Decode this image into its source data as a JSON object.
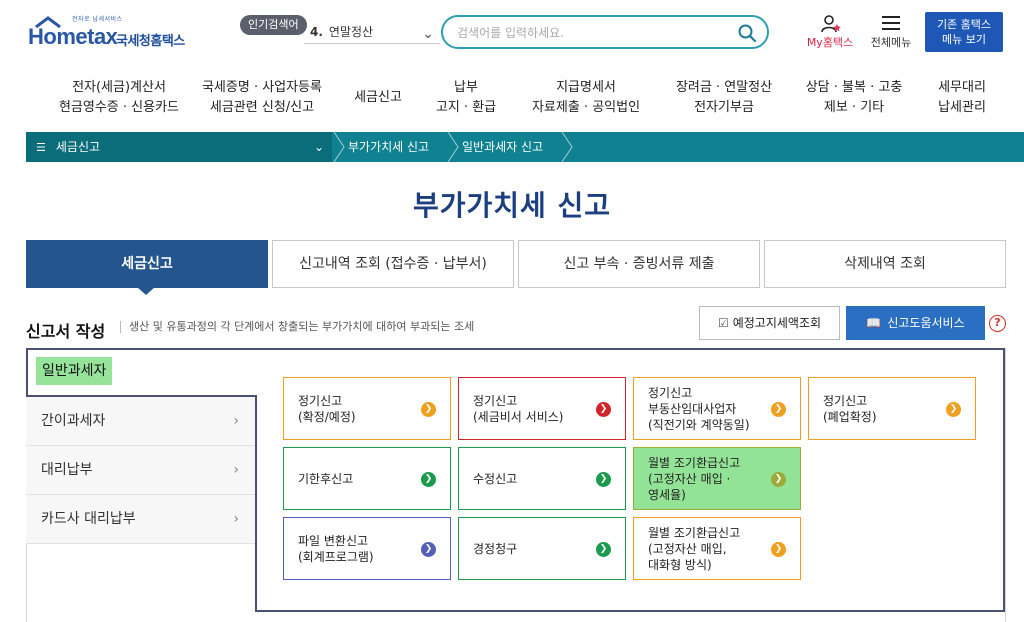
{
  "header": {
    "logo_tag": "전자로 납세서비스",
    "logo_main": "Hometax",
    "logo_kr": "국세청홈택스",
    "popular_badge": "인기검색어",
    "popular_rank": "4.",
    "popular_term": "연말정산",
    "search_placeholder": "검색어를 입력하세요.",
    "my_hometax": "My홈택스",
    "all_menu": "전체메뉴",
    "legacy_line1": "기존 홈택스",
    "legacy_line2": "메뉴 보기"
  },
  "gnb": [
    {
      "line1": "전자(세금)계산서",
      "line2": "현금영수증 · 신용카드"
    },
    {
      "line1": "국세증명 · 사업자등록",
      "line2": "세금관련 신청/신고"
    },
    {
      "line1": "세금신고",
      "line2": ""
    },
    {
      "line1": "납부",
      "line2": "고지 · 환급"
    },
    {
      "line1": "지급명세서",
      "line2": "자료제출 · 공익법인"
    },
    {
      "line1": "장려금 · 연말정산",
      "line2": "전자기부금"
    },
    {
      "line1": "상담 · 불복 · 고충",
      "line2": "제보 · 기타"
    },
    {
      "line1": "세무대리",
      "line2": "납세관리"
    }
  ],
  "breadcrumb": {
    "menu": "세금신고",
    "level1": "부가가치세 신고",
    "level2": "일반과세자 신고"
  },
  "page_title": "부가가치세 신고",
  "tabs": [
    {
      "label": "세금신고"
    },
    {
      "label": "신고내역 조회 (접수증 · 납부서)"
    },
    {
      "label": "신고 부속 · 증빙서류 제출"
    },
    {
      "label": "삭제내역 조회"
    }
  ],
  "section": {
    "title": "신고서 작성",
    "desc": "생산 및 유통과정의 각 단계에서 창출되는 부가가치에 대하여 부과되는 조세",
    "prenotice_btn": "예정고지세액조회",
    "help_btn": "신고도움서비스",
    "help_q": "?"
  },
  "side": {
    "active": "일반과세자",
    "items": [
      {
        "label": "간이과세자"
      },
      {
        "label": "대리납부"
      },
      {
        "label": "카드사 대리납부"
      }
    ]
  },
  "cards": [
    {
      "text": "정기신고\n(확정/예정)",
      "color": "#f0a020"
    },
    {
      "text": "정기신고\n(세금비서 서비스)",
      "color": "#d0262b"
    },
    {
      "text": "정기신고\n부동산임대사업자\n(직전기와 계약동일)",
      "color": "#f0a020"
    },
    {
      "text": "정기신고\n(폐업확정)",
      "color": "#f0a020"
    },
    {
      "text": "기한후신고",
      "color": "#1c9b4f"
    },
    {
      "text": "수정신고",
      "color": "#1c9b4f"
    },
    {
      "text": "월별 조기환급신고\n(고정자산 매입 ·\n영세율)",
      "color": "#9aab3a"
    },
    {
      "text": "파일 변환신고\n(회계프로그램)",
      "color": "#5460b8"
    },
    {
      "text": "경정청구",
      "color": "#1c9b4f"
    },
    {
      "text": "월별 조기환급신고\n(고정자산 매입,\n대화형 방식)",
      "color": "#f0a020"
    }
  ],
  "colors": {
    "brand": "#1f57b6",
    "teal_bar": "#0f8190",
    "active_tab": "#24558f",
    "panel_border": "#4a5175",
    "highlight": "#93e397"
  }
}
